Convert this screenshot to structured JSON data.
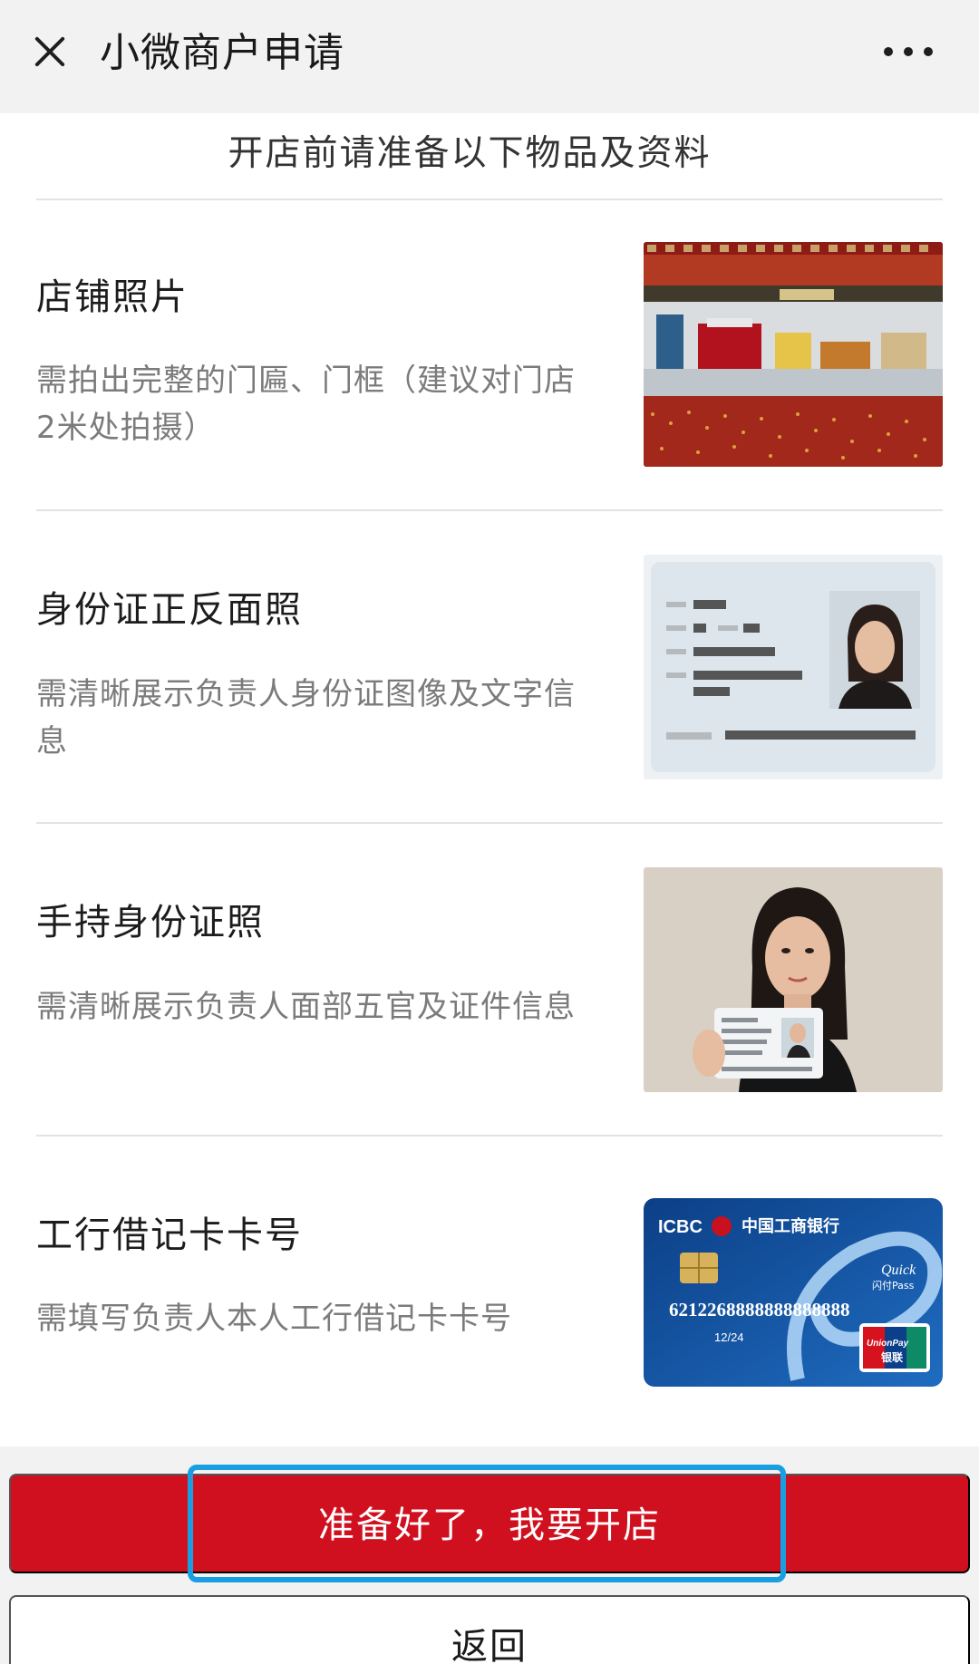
{
  "header": {
    "close_icon": "close-icon",
    "title": "小微商户申请",
    "more_icon": "more-icon"
  },
  "intro": {
    "heading": "开店前请准备以下物品及资料"
  },
  "items": [
    {
      "title": "店铺照片",
      "description": "需拍出完整的门匾、门框（建议对门店2米处拍摄）",
      "image": "storefront-photo"
    },
    {
      "title": "身份证正反面照",
      "description": "需清晰展示负责人身份证图像及文字信息",
      "image": "id-card-photo"
    },
    {
      "title": "手持身份证照",
      "description": "需清晰展示负责人面部五官及证件信息",
      "image": "person-holding-id-photo"
    },
    {
      "title": "工行借记卡卡号",
      "description": "需填写负责人本人工行借记卡卡号",
      "image": "bank-card-photo"
    }
  ],
  "bank_card": {
    "brand": "ICBC",
    "bank_name": "中国工商银行",
    "card_number": "6212268888888888888",
    "expiry": "12/24",
    "quickpass_line1": "Quick",
    "quickpass_line2": "闪付Pass",
    "unionpay_line1": "UnionPay",
    "unionpay_line2": "银联"
  },
  "actions": {
    "primary_label": "准备好了，我要开店",
    "secondary_label": "返回"
  },
  "colors": {
    "primary_red": "#d0101f",
    "highlight_blue": "#1a9ee2",
    "header_bg": "#f2f2f2",
    "title_text": "#1c1c1c",
    "desc_text": "#7b7b7b"
  }
}
